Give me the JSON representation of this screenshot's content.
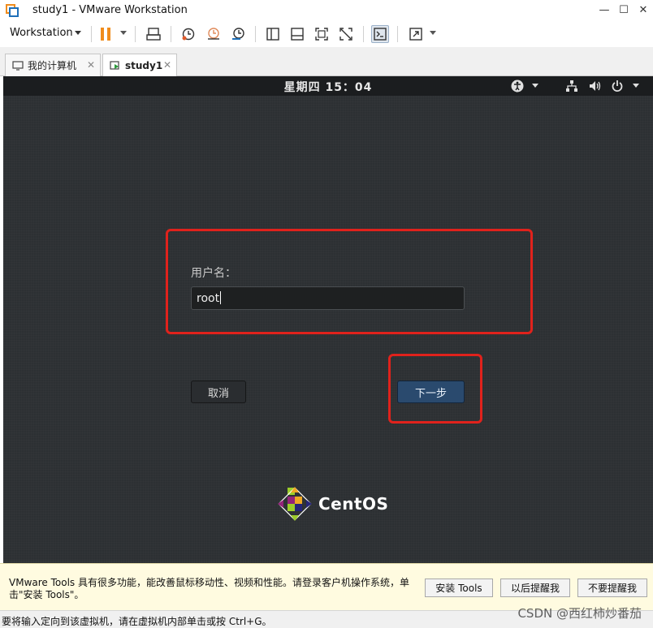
{
  "window": {
    "title": "study1 - VMware Workstation",
    "min_glyph": "—",
    "max_glyph": "☐",
    "close_glyph": "✕"
  },
  "toolbar": {
    "menu_label": "Workstation",
    "icons": [
      "pause-icon",
      "send-ctrl-alt-del-icon",
      "snapshot-icon",
      "revert-snapshot-icon",
      "snapshot-manager-icon",
      "show-library-icon",
      "thumbnail-bar-icon",
      "full-screen-icon",
      "unity-icon",
      "console-view-icon",
      "stretch-icon"
    ]
  },
  "tabs": [
    {
      "label": "我的计算机",
      "close": "✕"
    },
    {
      "label": "study1",
      "close": "✕"
    }
  ],
  "guest": {
    "clock": "星期四 15：04",
    "username_label": "用户名：",
    "username_value": "root",
    "cancel_label": "取消",
    "next_label": "下一步",
    "logo_text": "CentOS",
    "highlight_color": "#e0221c"
  },
  "tools_notice": {
    "message": "VMware Tools 具有很多功能，能改善鼠标移动性、视频和性能。请登录客户机操作系统，单击\"安装 Tools\"。",
    "install_label": "安装 Tools",
    "remind_later_label": "以后提醒我",
    "never_remind_label": "不要提醒我"
  },
  "status": {
    "text": "要将输入定向到该虚拟机，请在虚拟机内部单击或按 Ctrl+G。",
    "watermark": "CSDN @西红柿炒番茄"
  }
}
